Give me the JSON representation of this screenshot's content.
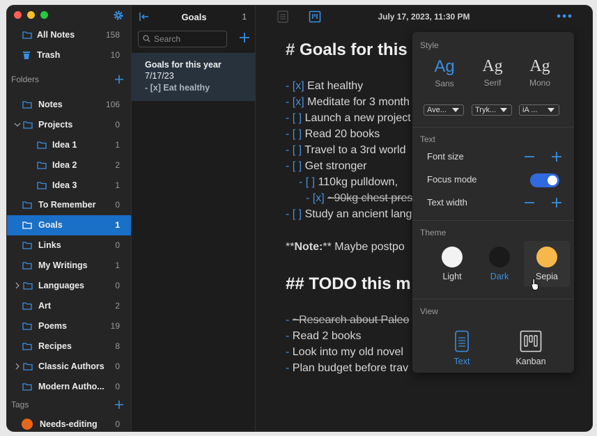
{
  "sidebar": {
    "all_notes": {
      "label": "All Notes",
      "count": "158"
    },
    "trash": {
      "label": "Trash",
      "count": "10"
    },
    "folders_heading": "Folders",
    "folders": [
      {
        "label": "Notes",
        "count": "106"
      },
      {
        "label": "Projects",
        "count": "0"
      },
      {
        "label": "Idea 1",
        "count": "1"
      },
      {
        "label": "Idea 2",
        "count": "2"
      },
      {
        "label": "Idea 3",
        "count": "1"
      },
      {
        "label": "To Remember",
        "count": "0"
      },
      {
        "label": "Goals",
        "count": "1"
      },
      {
        "label": "Links",
        "count": "0"
      },
      {
        "label": "My Writings",
        "count": "1"
      },
      {
        "label": "Languages",
        "count": "0"
      },
      {
        "label": "Art",
        "count": "2"
      },
      {
        "label": "Poems",
        "count": "19"
      },
      {
        "label": "Recipes",
        "count": "8"
      },
      {
        "label": "Classic Authors",
        "count": "0"
      },
      {
        "label": "Modern Autho...",
        "count": "0"
      }
    ],
    "tags_heading": "Tags",
    "tags": [
      {
        "label": "Needs-editing",
        "count": "0",
        "color": "#e8661a"
      }
    ]
  },
  "list": {
    "title": "Goals",
    "count": "1",
    "search_placeholder": "Search",
    "note": {
      "title": "Goals for this year",
      "date": "7/17/23",
      "preview": "- [x] Eat healthy"
    }
  },
  "editor": {
    "date": "July 17, 2023, 11:30 PM",
    "h1": {
      "marker": "#",
      "text": "Goals for this"
    },
    "items": [
      {
        "mk": "- [x]",
        "text": "Eat healthy"
      },
      {
        "mk": "- [x]",
        "text": "Meditate for 3 month"
      },
      {
        "mk": "- [ ]",
        "text": "Launch a new project"
      },
      {
        "mk": "- [ ]",
        "text": "Read 20 books"
      },
      {
        "mk": "- [ ]",
        "text": "Travel to a 3rd world"
      },
      {
        "mk": "- [ ]",
        "text": "Get stronger"
      },
      {
        "mk": "- [ ]",
        "text": "110kg pulldown,"
      },
      {
        "mk": "- [x]",
        "text": "~90kg chest press"
      },
      {
        "mk": "- [ ]",
        "text": "Study an ancient lang"
      }
    ],
    "note_line": {
      "pre": "**",
      "bold": "Note:",
      "rest": "** Maybe postpo"
    },
    "h2": {
      "marker": "##",
      "text": "TODO this m"
    },
    "todo": [
      {
        "mk": "-",
        "text": "~Research about Paleo"
      },
      {
        "mk": "-",
        "text": "Read 2 books"
      },
      {
        "mk": "-",
        "text": "Look into my old novel"
      },
      {
        "mk": "-",
        "text": "Plan budget before trav"
      }
    ]
  },
  "popover": {
    "style_heading": "Style",
    "fonts": [
      {
        "glyph": "Ag",
        "name": "Sans",
        "select": "Ave..."
      },
      {
        "glyph": "Ag",
        "name": "Serif",
        "select": "Tryk..."
      },
      {
        "glyph": "Ag",
        "name": "Mono",
        "select": "iA ..."
      }
    ],
    "text_heading": "Text",
    "font_size_label": "Font size",
    "focus_mode_label": "Focus mode",
    "focus_mode_on": true,
    "text_width_label": "Text width",
    "theme_heading": "Theme",
    "themes": [
      {
        "name": "Light",
        "color": "#f2f2f2"
      },
      {
        "name": "Dark",
        "color": "#1a1a1a"
      },
      {
        "name": "Sepia",
        "color": "#f7b84b"
      }
    ],
    "view_heading": "View",
    "views": [
      {
        "name": "Text"
      },
      {
        "name": "Kanban"
      }
    ]
  },
  "colors": {
    "accent": "#1a6fc7",
    "selection": "#27323d"
  }
}
